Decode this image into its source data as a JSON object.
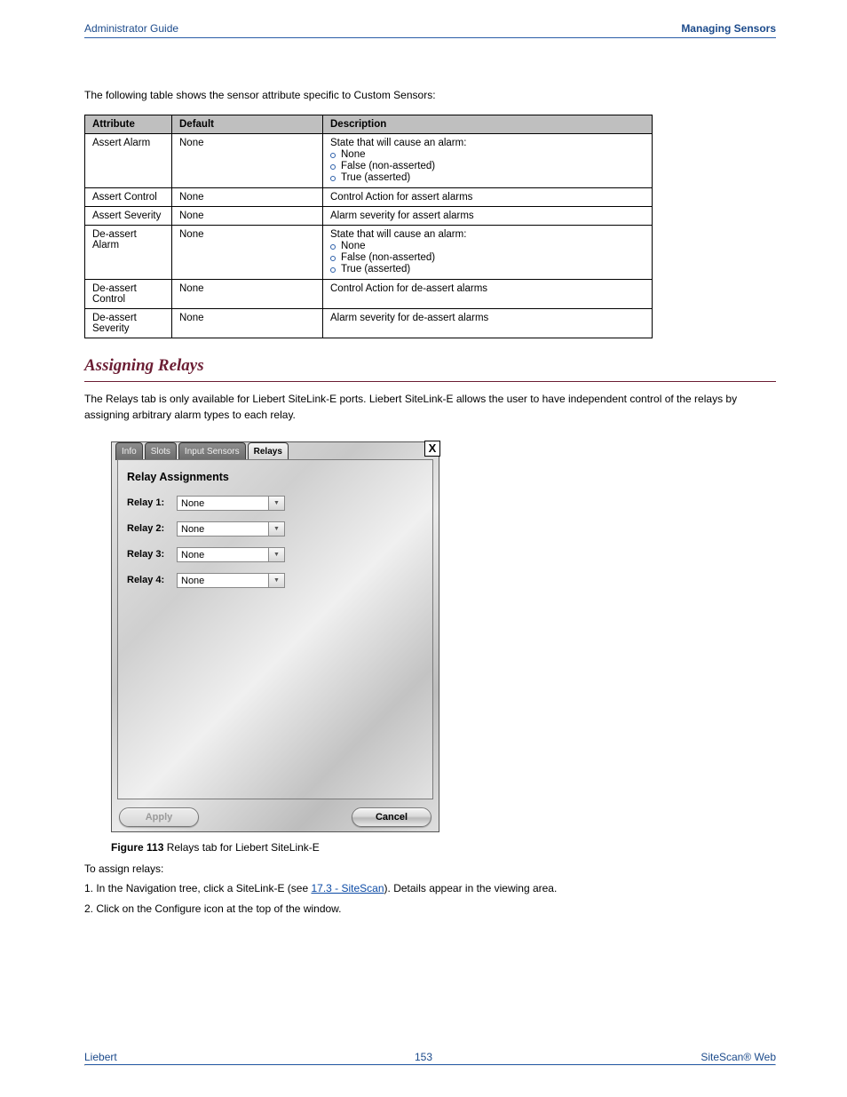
{
  "header": {
    "left": "Administrator Guide",
    "right": "Managing Sensors"
  },
  "intro": "The following table shows the sensor attribute specific to Custom Sensors:",
  "table": {
    "head": [
      "Attribute",
      "Default",
      "Description"
    ],
    "rows": [
      {
        "attr": "Assert Alarm",
        "def": "None",
        "desc_lead": "State that will cause an alarm:",
        "bullets": [
          "None",
          "False (non-asserted)",
          "True (asserted)"
        ]
      },
      {
        "attr": "Assert Control",
        "def": "None",
        "desc": "Control Action for assert alarms"
      },
      {
        "attr": "Assert Severity",
        "def": "None",
        "desc": "Alarm severity for assert alarms"
      },
      {
        "attr": "De-assert Alarm",
        "def": "None",
        "desc_lead": "State that will cause an alarm:",
        "bullets": [
          "None",
          "False (non-asserted)",
          "True (asserted)"
        ]
      },
      {
        "attr": "De-assert Control",
        "def": "None",
        "desc": "Control Action for de-assert alarms"
      },
      {
        "attr": "De-assert Severity",
        "def": "None",
        "desc": "Alarm severity for de-assert alarms"
      }
    ]
  },
  "section": {
    "title": "Assigning Relays",
    "para": "The Relays tab is only available for Liebert SiteLink-E ports. Liebert SiteLink-E allows the user to have independent control of the relays by assigning arbitrary alarm types to each relay."
  },
  "dialog": {
    "tabs": [
      "Info",
      "Slots",
      "Input Sensors",
      "Relays"
    ],
    "activeTabIndex": 3,
    "closeLabel": "X",
    "title": "Relay Assignments",
    "rows": [
      {
        "label": "Relay 1:",
        "value": "None"
      },
      {
        "label": "Relay 2:",
        "value": "None"
      },
      {
        "label": "Relay 3:",
        "value": "None"
      },
      {
        "label": "Relay 4:",
        "value": "None"
      }
    ],
    "apply": "Apply",
    "cancel": "Cancel"
  },
  "figure": {
    "label": "Figure 113",
    "caption": "Relays tab for Liebert SiteLink-E"
  },
  "body": {
    "steps_lead": "To assign relays:",
    "step1a": "1. In the Navigation tree, click a SiteLink-E (see",
    "step1_link": "17.3 - SiteScan",
    "step1b": "). Details appear in the viewing area.",
    "step2": "2. Click on the Configure icon at the top of the window."
  },
  "footer": {
    "left": "Liebert",
    "page": "153",
    "right": "SiteScan® Web"
  }
}
